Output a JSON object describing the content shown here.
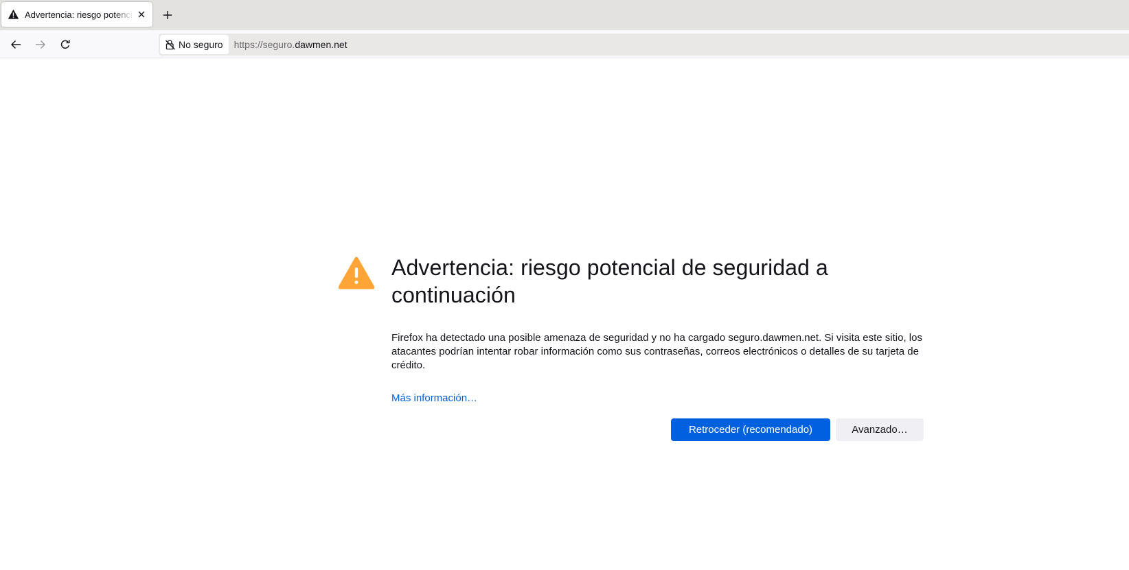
{
  "tab": {
    "title": "Advertencia: riesgo potencial de seguridad a continuación",
    "icon": "warning-icon"
  },
  "navbar": {
    "identity_label": "No seguro",
    "url_prefix": "https://seguro.",
    "url_host": "dawmen.net"
  },
  "page": {
    "title": "Advertencia: riesgo potencial de seguridad a continuación",
    "description": "Firefox ha detectado una posible amenaza de seguridad y no ha cargado seguro.dawmen.net. Si visita este sitio, los atacantes podrían intentar robar información como sus contraseñas, correos electrónicos o detalles de su tarjeta de crédito.",
    "learn_more": "Más información…",
    "primary_button": "Retroceder (recomendado)",
    "secondary_button": "Avanzado…"
  },
  "colors": {
    "accent": "#0061e0",
    "warning": "#ffa436",
    "text": "#15141a"
  }
}
